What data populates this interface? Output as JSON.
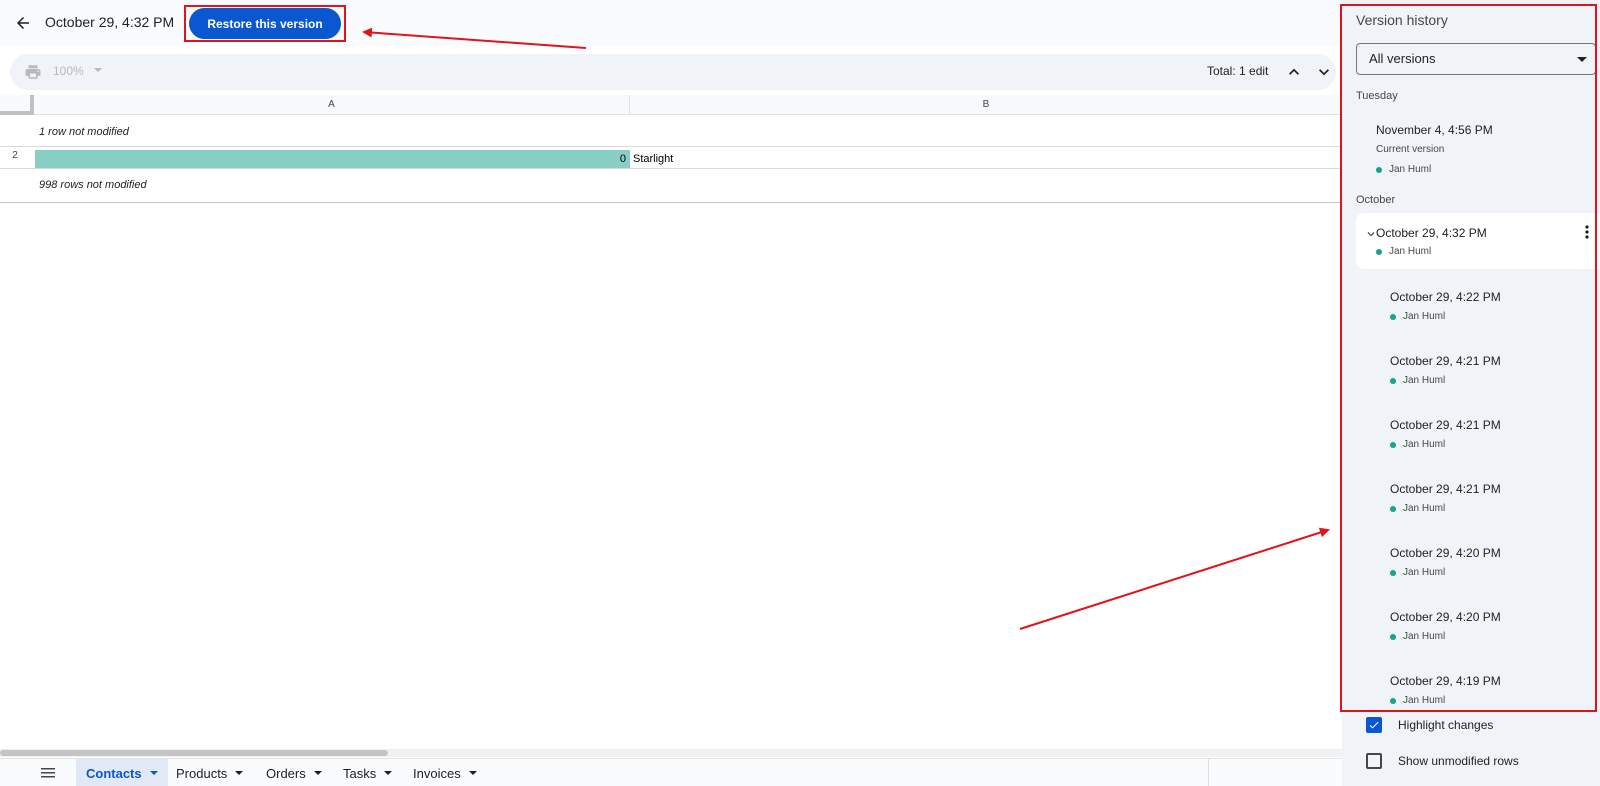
{
  "header": {
    "version_title": "October 29, 4:32 PM",
    "restore_label": "Restore this version"
  },
  "toolbar": {
    "zoom": "100%",
    "total_edits": "Total: 1 edit"
  },
  "grid": {
    "columns": [
      "A",
      "B"
    ],
    "note_top": "1 row not modified",
    "row_number": "2",
    "cell_a": "0",
    "cell_b": "Starlight",
    "note_bottom": "998 rows not modified"
  },
  "sheets": {
    "tabs": [
      "Contacts",
      "Products",
      "Orders",
      "Tasks",
      "Invoices"
    ],
    "active": "Contacts"
  },
  "panel": {
    "title": "Version history",
    "filter": "All versions",
    "sections": {
      "tuesday": "Tuesday",
      "october": "October"
    },
    "current": {
      "date": "November 4, 4:56 PM",
      "sub": "Current version",
      "author": "Jan Huml"
    },
    "selected": {
      "date": "October 29, 4:32 PM",
      "author": "Jan Huml"
    },
    "versions": [
      {
        "date": "October 29, 4:22 PM",
        "author": "Jan Huml"
      },
      {
        "date": "October 29, 4:21 PM",
        "author": "Jan Huml"
      },
      {
        "date": "October 29, 4:21 PM",
        "author": "Jan Huml"
      },
      {
        "date": "October 29, 4:21 PM",
        "author": "Jan Huml"
      },
      {
        "date": "October 29, 4:20 PM",
        "author": "Jan Huml"
      },
      {
        "date": "October 29, 4:20 PM",
        "author": "Jan Huml"
      },
      {
        "date": "October 29, 4:19 PM",
        "author": "Jan Huml"
      }
    ],
    "options": {
      "highlight_changes": "Highlight changes",
      "highlight_checked": true,
      "show_unmodified": "Show unmodified rows",
      "show_unmodified_checked": false
    }
  },
  "colors": {
    "accent": "#0b57d0",
    "changed_cell": "#88d0c5",
    "author_dot": "#16a28b",
    "annotation": "#e0141c"
  }
}
